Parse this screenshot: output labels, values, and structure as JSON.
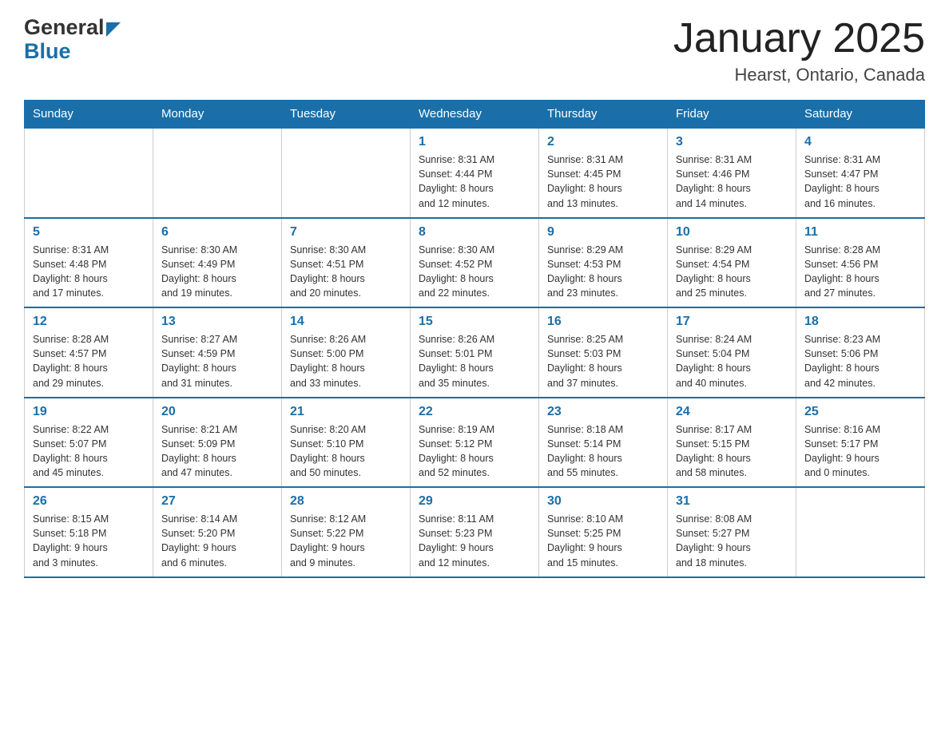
{
  "header": {
    "logo": {
      "general": "General",
      "blue": "Blue"
    },
    "title": "January 2025",
    "subtitle": "Hearst, Ontario, Canada"
  },
  "days_of_week": [
    "Sunday",
    "Monday",
    "Tuesday",
    "Wednesday",
    "Thursday",
    "Friday",
    "Saturday"
  ],
  "weeks": [
    [
      {
        "day": "",
        "info": ""
      },
      {
        "day": "",
        "info": ""
      },
      {
        "day": "",
        "info": ""
      },
      {
        "day": "1",
        "info": "Sunrise: 8:31 AM\nSunset: 4:44 PM\nDaylight: 8 hours\nand 12 minutes."
      },
      {
        "day": "2",
        "info": "Sunrise: 8:31 AM\nSunset: 4:45 PM\nDaylight: 8 hours\nand 13 minutes."
      },
      {
        "day": "3",
        "info": "Sunrise: 8:31 AM\nSunset: 4:46 PM\nDaylight: 8 hours\nand 14 minutes."
      },
      {
        "day": "4",
        "info": "Sunrise: 8:31 AM\nSunset: 4:47 PM\nDaylight: 8 hours\nand 16 minutes."
      }
    ],
    [
      {
        "day": "5",
        "info": "Sunrise: 8:31 AM\nSunset: 4:48 PM\nDaylight: 8 hours\nand 17 minutes."
      },
      {
        "day": "6",
        "info": "Sunrise: 8:30 AM\nSunset: 4:49 PM\nDaylight: 8 hours\nand 19 minutes."
      },
      {
        "day": "7",
        "info": "Sunrise: 8:30 AM\nSunset: 4:51 PM\nDaylight: 8 hours\nand 20 minutes."
      },
      {
        "day": "8",
        "info": "Sunrise: 8:30 AM\nSunset: 4:52 PM\nDaylight: 8 hours\nand 22 minutes."
      },
      {
        "day": "9",
        "info": "Sunrise: 8:29 AM\nSunset: 4:53 PM\nDaylight: 8 hours\nand 23 minutes."
      },
      {
        "day": "10",
        "info": "Sunrise: 8:29 AM\nSunset: 4:54 PM\nDaylight: 8 hours\nand 25 minutes."
      },
      {
        "day": "11",
        "info": "Sunrise: 8:28 AM\nSunset: 4:56 PM\nDaylight: 8 hours\nand 27 minutes."
      }
    ],
    [
      {
        "day": "12",
        "info": "Sunrise: 8:28 AM\nSunset: 4:57 PM\nDaylight: 8 hours\nand 29 minutes."
      },
      {
        "day": "13",
        "info": "Sunrise: 8:27 AM\nSunset: 4:59 PM\nDaylight: 8 hours\nand 31 minutes."
      },
      {
        "day": "14",
        "info": "Sunrise: 8:26 AM\nSunset: 5:00 PM\nDaylight: 8 hours\nand 33 minutes."
      },
      {
        "day": "15",
        "info": "Sunrise: 8:26 AM\nSunset: 5:01 PM\nDaylight: 8 hours\nand 35 minutes."
      },
      {
        "day": "16",
        "info": "Sunrise: 8:25 AM\nSunset: 5:03 PM\nDaylight: 8 hours\nand 37 minutes."
      },
      {
        "day": "17",
        "info": "Sunrise: 8:24 AM\nSunset: 5:04 PM\nDaylight: 8 hours\nand 40 minutes."
      },
      {
        "day": "18",
        "info": "Sunrise: 8:23 AM\nSunset: 5:06 PM\nDaylight: 8 hours\nand 42 minutes."
      }
    ],
    [
      {
        "day": "19",
        "info": "Sunrise: 8:22 AM\nSunset: 5:07 PM\nDaylight: 8 hours\nand 45 minutes."
      },
      {
        "day": "20",
        "info": "Sunrise: 8:21 AM\nSunset: 5:09 PM\nDaylight: 8 hours\nand 47 minutes."
      },
      {
        "day": "21",
        "info": "Sunrise: 8:20 AM\nSunset: 5:10 PM\nDaylight: 8 hours\nand 50 minutes."
      },
      {
        "day": "22",
        "info": "Sunrise: 8:19 AM\nSunset: 5:12 PM\nDaylight: 8 hours\nand 52 minutes."
      },
      {
        "day": "23",
        "info": "Sunrise: 8:18 AM\nSunset: 5:14 PM\nDaylight: 8 hours\nand 55 minutes."
      },
      {
        "day": "24",
        "info": "Sunrise: 8:17 AM\nSunset: 5:15 PM\nDaylight: 8 hours\nand 58 minutes."
      },
      {
        "day": "25",
        "info": "Sunrise: 8:16 AM\nSunset: 5:17 PM\nDaylight: 9 hours\nand 0 minutes."
      }
    ],
    [
      {
        "day": "26",
        "info": "Sunrise: 8:15 AM\nSunset: 5:18 PM\nDaylight: 9 hours\nand 3 minutes."
      },
      {
        "day": "27",
        "info": "Sunrise: 8:14 AM\nSunset: 5:20 PM\nDaylight: 9 hours\nand 6 minutes."
      },
      {
        "day": "28",
        "info": "Sunrise: 8:12 AM\nSunset: 5:22 PM\nDaylight: 9 hours\nand 9 minutes."
      },
      {
        "day": "29",
        "info": "Sunrise: 8:11 AM\nSunset: 5:23 PM\nDaylight: 9 hours\nand 12 minutes."
      },
      {
        "day": "30",
        "info": "Sunrise: 8:10 AM\nSunset: 5:25 PM\nDaylight: 9 hours\nand 15 minutes."
      },
      {
        "day": "31",
        "info": "Sunrise: 8:08 AM\nSunset: 5:27 PM\nDaylight: 9 hours\nand 18 minutes."
      },
      {
        "day": "",
        "info": ""
      }
    ]
  ]
}
